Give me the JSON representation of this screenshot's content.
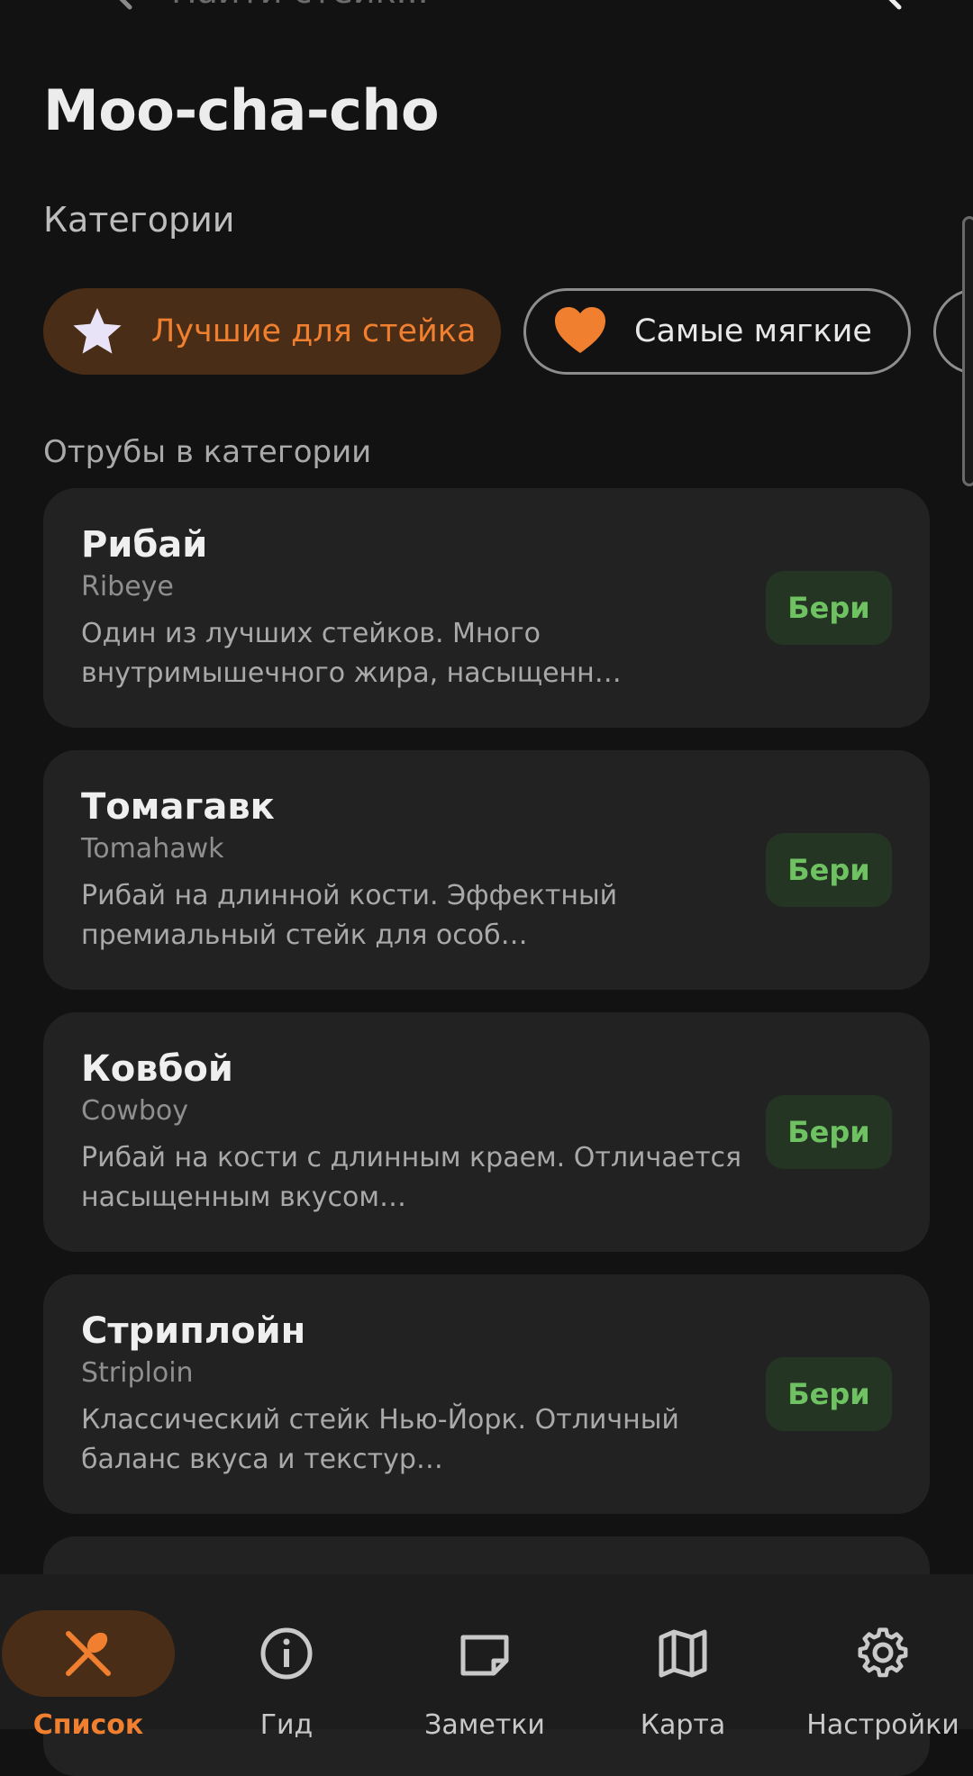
{
  "search": {
    "placeholder": "Найти стейк...",
    "icon_left": "search-icon",
    "icon_right": "search-icon"
  },
  "app": {
    "title": "Moo-cha-cho"
  },
  "categories_section": {
    "title": "Категории",
    "chips": [
      {
        "label": "Лучшие для стейка",
        "icon": "star-icon",
        "selected": true
      },
      {
        "label": "Самые мягкие",
        "icon": "heart-icon",
        "selected": false
      },
      {
        "label": "",
        "icon": "category-icon",
        "selected": false
      }
    ]
  },
  "cuts_section": {
    "title": "Отрубы в категории",
    "cards": [
      {
        "name": "Рибай",
        "latin": "Ribeye",
        "description": "Один из лучших стейков. Много внутримышечного жира, насыщенн…",
        "button": "Бери"
      },
      {
        "name": "Томагавк",
        "latin": "Tomahawk",
        "description": "Рибай на длинной кости. Эффектный премиальный стейк для особ…",
        "button": "Бери"
      },
      {
        "name": "Ковбой",
        "latin": "Cowboy",
        "description": "Рибай на кости с длинным краем. Отличается насыщенным вкусом…",
        "button": "Бери"
      },
      {
        "name": "Стриплойн",
        "latin": "Striploin",
        "description": "Классический стейк Нью-Йорк. Отличный баланс вкуса и текстур…",
        "button": "Бери"
      }
    ]
  },
  "bottom_nav": {
    "items": [
      {
        "label": "Список",
        "icon": "fork-knife-icon",
        "active": true
      },
      {
        "label": "Гид",
        "icon": "info-icon",
        "active": false
      },
      {
        "label": "Заметки",
        "icon": "note-icon",
        "active": false
      },
      {
        "label": "Карта",
        "icon": "map-icon",
        "active": false
      },
      {
        "label": "Настройки",
        "icon": "gear-icon",
        "active": false
      }
    ]
  },
  "colors": {
    "background": "#121212",
    "card": "#222222",
    "accent": "#f0802f",
    "accent_bg": "#4a2d17",
    "button_text": "#6fc261",
    "button_bg": "#243524"
  }
}
